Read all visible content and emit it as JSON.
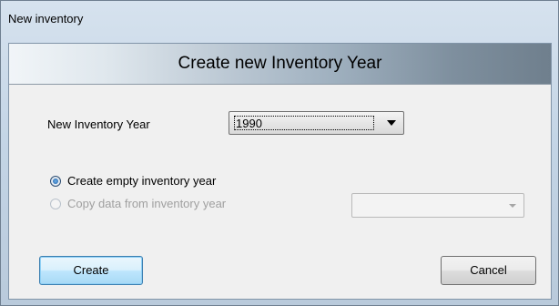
{
  "window": {
    "title": "New inventory"
  },
  "banner": {
    "title": "Create new Inventory Year"
  },
  "year_field": {
    "label": "New Inventory Year",
    "selected": "1990"
  },
  "options": {
    "empty": {
      "label": "Create empty inventory year",
      "checked": true,
      "enabled": true
    },
    "copy": {
      "label": "Copy data from inventory year",
      "checked": false,
      "enabled": false,
      "selected": ""
    }
  },
  "buttons": {
    "create": "Create",
    "cancel": "Cancel"
  },
  "icons": {
    "year_dropdown": "chevron-down-icon",
    "copy_dropdown": "chevron-down-icon"
  }
}
